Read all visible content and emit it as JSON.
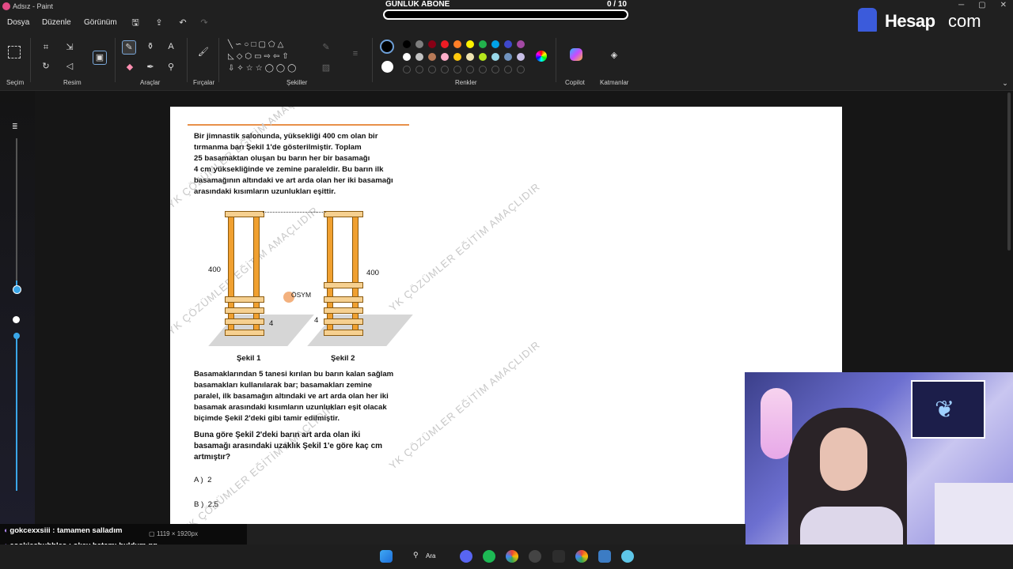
{
  "app": {
    "title": "Adsız - Paint"
  },
  "menu": {
    "file": "Dosya",
    "edit": "Düzenle",
    "view": "Görünüm"
  },
  "ribbon": {
    "groups": {
      "selection": "Seçim",
      "image": "Resim",
      "tools": "Araçlar",
      "brushes": "Fırçalar",
      "shapes": "Şekiller",
      "colors": "Renkler",
      "copilot": "Copilot",
      "layers": "Katmanlar"
    },
    "colors_row1": [
      "#000000",
      "#7f7f7f",
      "#880015",
      "#ed1c24",
      "#ff7f27",
      "#fff200",
      "#22b14c",
      "#00a2e8",
      "#3f48cc",
      "#a349a4"
    ],
    "colors_row2": [
      "#ffffff",
      "#c3c3c3",
      "#b97a57",
      "#ffaec9",
      "#ffc90e",
      "#efe4b0",
      "#b5e61d",
      "#99d9ea",
      "#7092be",
      "#c8bfe7"
    ]
  },
  "overlay": {
    "sub_goal_label": "GÜNLÜK ABONE",
    "sub_goal_count": "0  / 10",
    "sub_goal_progress": 0,
    "brand_word": "Hesap",
    "brand_suffix": "com"
  },
  "document": {
    "paragraph1": [
      "Bir jimnastik salonunda, yüksekliği 400 cm olan bir",
      "tırmanma barı Şekil 1'de gösterilmiştir. Toplam",
      "25 basamaktan oluşan bu barın her bir basamağı",
      "4 cm yüksekliğinde ve zemine paraleldir. Bu barın ilk",
      "basamağının altındaki ve art arda olan her iki basamağı",
      "arasındaki kısımların uzunlukları eşittir."
    ],
    "figure": {
      "label1": "Şekil 1",
      "label2": "Şekil 2",
      "h_left": "400",
      "h_right": "400",
      "step_left": "4",
      "step_right": "4",
      "logo": "ÖSYM"
    },
    "paragraph2": [
      "Basamaklarından 5 tanesi kırılan bu barın kalan sağlam",
      "basamakları kullanılarak bar; basamakları zemine",
      "paralel, ilk basamağın altındaki ve art arda olan her iki",
      "basamak arasındaki kısımların uzunlukları eşit olacak",
      "biçimde Şekil 2'deki gibi tamir edilmiştir."
    ],
    "question": [
      "Buna göre Şekil 2'deki barın art arda olan iki",
      "basamağı arasındaki uzaklık Şekil 1'e göre kaç cm",
      "artmıştır?"
    ],
    "options": [
      {
        "key": "A )",
        "value": "2"
      },
      {
        "key": "B )",
        "value": "2,5"
      }
    ],
    "watermark": "YK ÇÖZÜMLER EĞİTİM AMAÇLIDIR"
  },
  "status": {
    "canvas_size": "1119 × 1920px"
  },
  "chat": [
    {
      "user": "gokcexxsiii",
      "message": ": tamamen salladım"
    },
    {
      "user": "cookiesbubbles",
      "message": ": okey hatamı buldum gg"
    }
  ],
  "taskbar": {
    "search": "Ara"
  }
}
